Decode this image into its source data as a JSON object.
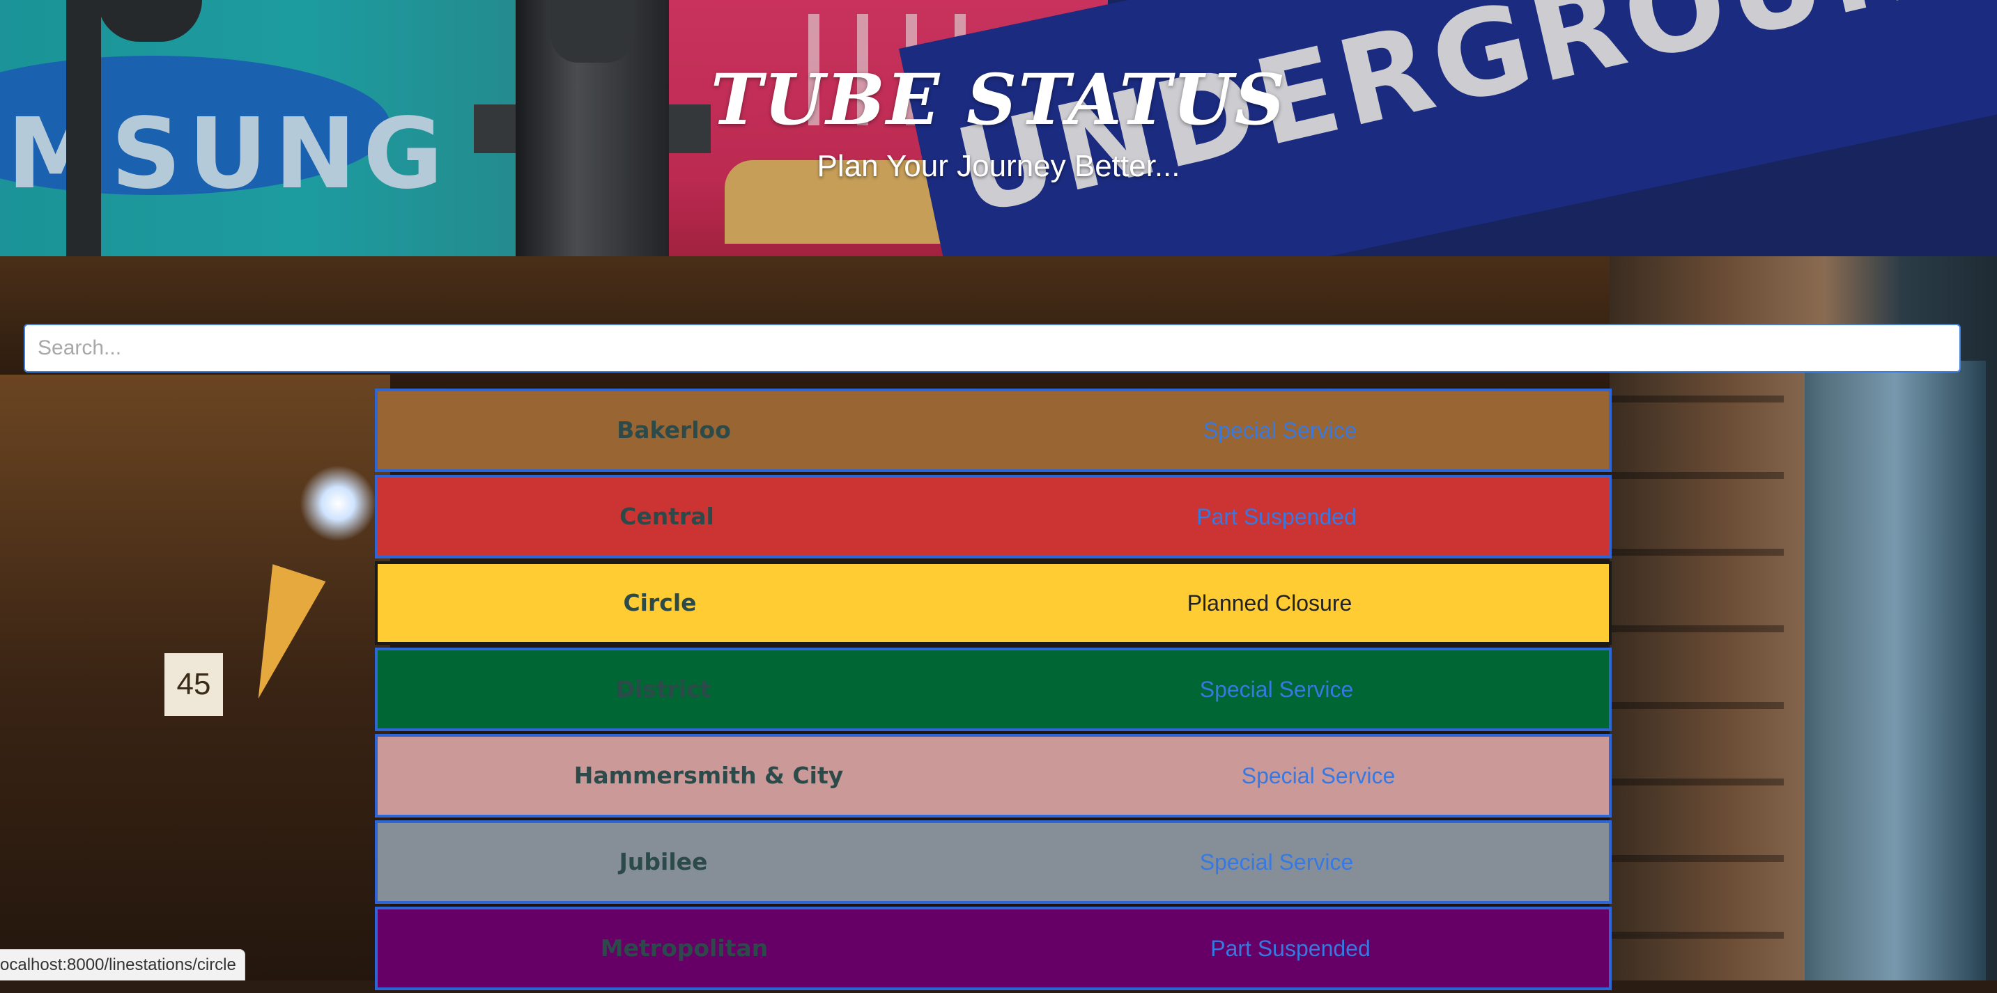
{
  "header": {
    "title": "TUBE STATUS",
    "subtitle": "Plan Your Journey Better...",
    "bg_text_left": "MSUNG",
    "bg_text_right": "UNDERGROUND"
  },
  "search": {
    "placeholder": "Search...",
    "value": ""
  },
  "lines": [
    {
      "name": "Bakerloo",
      "status": "Special Service",
      "color": "#996633"
    },
    {
      "name": "Central",
      "status": "Part Suspended",
      "color": "#CC3333"
    },
    {
      "name": "Circle",
      "status": "Planned Closure",
      "color": "#FFCC33",
      "selected": true
    },
    {
      "name": "District",
      "status": "Special Service",
      "color": "#006633"
    },
    {
      "name": "Hammersmith & City",
      "status": "Special Service",
      "color": "#CC9999"
    },
    {
      "name": "Jubilee",
      "status": "Special Service",
      "color": "#868F98"
    },
    {
      "name": "Metropolitan",
      "status": "Part Suspended",
      "color": "#660066"
    }
  ],
  "statusbar": {
    "url": "ocalhost:8000/linestations/circle"
  },
  "colors": {
    "row_border": "#2f66d6",
    "status_text": "#3779e0",
    "name_text": "#2c4a4a"
  }
}
